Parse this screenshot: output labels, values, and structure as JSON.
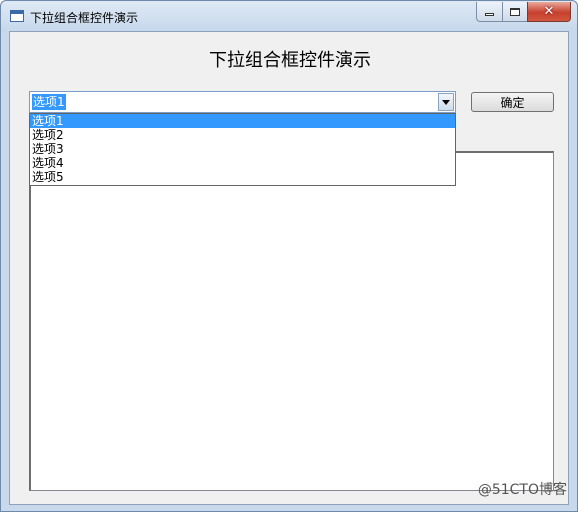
{
  "window": {
    "title": "下拉组合框控件演示"
  },
  "main": {
    "heading": "下拉组合框控件演示",
    "combo": {
      "selected": "选项1",
      "options": [
        "选项1",
        "选项2",
        "选项3",
        "选项4",
        "选项5"
      ]
    },
    "ok_label": "确定",
    "textarea_value": ""
  },
  "watermark": "@51CTO博客",
  "colors": {
    "selection": "#3399ff",
    "close_button": "#c7402d"
  }
}
